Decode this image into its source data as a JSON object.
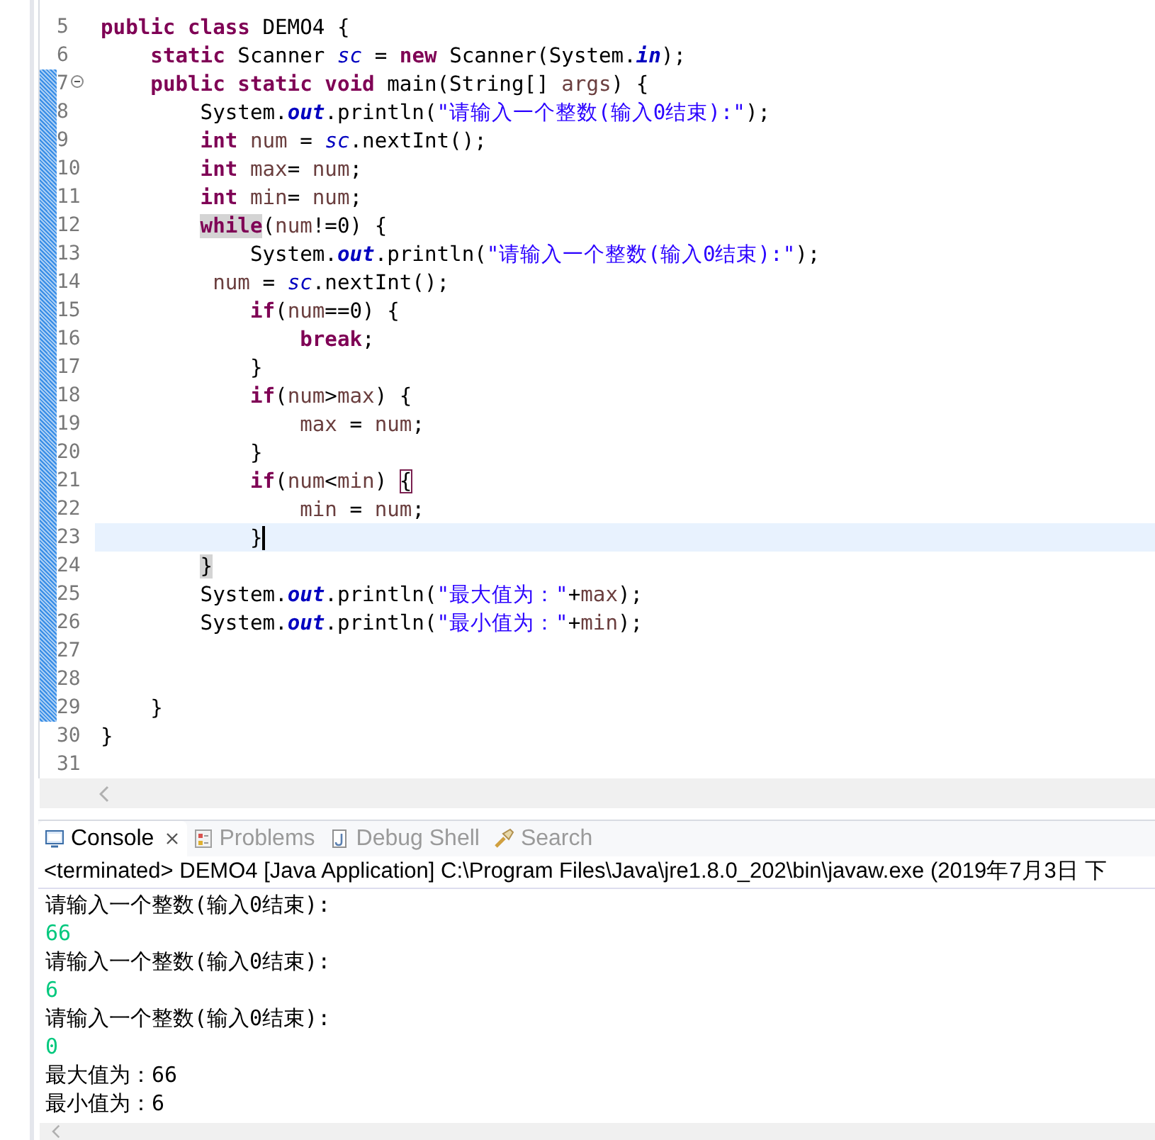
{
  "editor": {
    "lines": [
      {
        "number": "5",
        "changed": false,
        "current": false,
        "fold": false,
        "tokens": [
          {
            "kind": "kw",
            "text": "public class"
          },
          {
            "kind": "text",
            "text": " DEMO4 {"
          }
        ]
      },
      {
        "number": "6",
        "changed": false,
        "current": false,
        "fold": false,
        "tokens": [
          {
            "kind": "kw",
            "text": "    static"
          },
          {
            "kind": "text",
            "text": " Scanner "
          },
          {
            "kind": "field",
            "text": "sc"
          },
          {
            "kind": "text",
            "text": " = "
          },
          {
            "kind": "kw",
            "text": "new"
          },
          {
            "kind": "text",
            "text": " Scanner(System."
          },
          {
            "kind": "sfield",
            "text": "in"
          },
          {
            "kind": "text",
            "text": ");"
          }
        ]
      },
      {
        "number": "7",
        "changed": true,
        "current": false,
        "fold": true,
        "tokens": [
          {
            "kind": "kw",
            "text": "    public static void"
          },
          {
            "kind": "text",
            "text": " main(String[] "
          },
          {
            "kind": "var",
            "text": "args"
          },
          {
            "kind": "text",
            "text": ") {"
          }
        ]
      },
      {
        "number": "8",
        "changed": true,
        "current": false,
        "fold": false,
        "tokens": [
          {
            "kind": "text",
            "text": "        System."
          },
          {
            "kind": "sfield",
            "text": "out"
          },
          {
            "kind": "text",
            "text": ".println("
          },
          {
            "kind": "str",
            "text": "\"请输入一个整数(输入0结束):\""
          },
          {
            "kind": "text",
            "text": ");"
          }
        ]
      },
      {
        "number": "9",
        "changed": true,
        "current": false,
        "fold": false,
        "tokens": [
          {
            "kind": "kw",
            "text": "        int "
          },
          {
            "kind": "var",
            "text": "num"
          },
          {
            "kind": "text",
            "text": " = "
          },
          {
            "kind": "field",
            "text": "sc"
          },
          {
            "kind": "text",
            "text": ".nextInt();"
          }
        ]
      },
      {
        "number": "10",
        "changed": true,
        "current": false,
        "fold": false,
        "tokens": [
          {
            "kind": "kw",
            "text": "        int "
          },
          {
            "kind": "var",
            "text": "max"
          },
          {
            "kind": "text",
            "text": "= "
          },
          {
            "kind": "var",
            "text": "num"
          },
          {
            "kind": "text",
            "text": ";"
          }
        ]
      },
      {
        "number": "11",
        "changed": true,
        "current": false,
        "fold": false,
        "tokens": [
          {
            "kind": "kw",
            "text": "        int "
          },
          {
            "kind": "var",
            "text": "min"
          },
          {
            "kind": "text",
            "text": "= "
          },
          {
            "kind": "var",
            "text": "num"
          },
          {
            "kind": "text",
            "text": ";"
          }
        ]
      },
      {
        "number": "12",
        "changed": true,
        "current": false,
        "fold": false,
        "tokens": [
          {
            "kind": "kw",
            "text": "        while",
            "highlighted": true
          },
          {
            "kind": "text",
            "text": "("
          },
          {
            "kind": "var",
            "text": "num"
          },
          {
            "kind": "text",
            "text": "!=0) {"
          }
        ]
      },
      {
        "number": "13",
        "changed": true,
        "current": false,
        "fold": false,
        "tokens": [
          {
            "kind": "text",
            "text": "            System."
          },
          {
            "kind": "sfield",
            "text": "out"
          },
          {
            "kind": "text",
            "text": ".println("
          },
          {
            "kind": "str",
            "text": "\"请输入一个整数(输入0结束):\""
          },
          {
            "kind": "text",
            "text": ");"
          }
        ]
      },
      {
        "number": "14",
        "changed": true,
        "current": false,
        "fold": false,
        "tokens": [
          {
            "kind": "var",
            "text": "         num"
          },
          {
            "kind": "text",
            "text": " = "
          },
          {
            "kind": "field",
            "text": "sc"
          },
          {
            "kind": "text",
            "text": ".nextInt();"
          }
        ]
      },
      {
        "number": "15",
        "changed": true,
        "current": false,
        "fold": false,
        "tokens": [
          {
            "kind": "kw",
            "text": "            if"
          },
          {
            "kind": "text",
            "text": "("
          },
          {
            "kind": "var",
            "text": "num"
          },
          {
            "kind": "text",
            "text": "==0) {"
          }
        ]
      },
      {
        "number": "16",
        "changed": true,
        "current": false,
        "fold": false,
        "tokens": [
          {
            "kind": "kw",
            "text": "                break"
          },
          {
            "kind": "text",
            "text": ";"
          }
        ]
      },
      {
        "number": "17",
        "changed": true,
        "current": false,
        "fold": false,
        "tokens": [
          {
            "kind": "text",
            "text": "            }"
          }
        ]
      },
      {
        "number": "18",
        "changed": true,
        "current": false,
        "fold": false,
        "tokens": [
          {
            "kind": "kw",
            "text": "            if"
          },
          {
            "kind": "text",
            "text": "("
          },
          {
            "kind": "var",
            "text": "num"
          },
          {
            "kind": "text",
            "text": ">"
          },
          {
            "kind": "var",
            "text": "max"
          },
          {
            "kind": "text",
            "text": ") {"
          }
        ]
      },
      {
        "number": "19",
        "changed": true,
        "current": false,
        "fold": false,
        "tokens": [
          {
            "kind": "var",
            "text": "                max"
          },
          {
            "kind": "text",
            "text": " = "
          },
          {
            "kind": "var",
            "text": "num"
          },
          {
            "kind": "text",
            "text": ";"
          }
        ]
      },
      {
        "number": "20",
        "changed": true,
        "current": false,
        "fold": false,
        "tokens": [
          {
            "kind": "text",
            "text": "            }"
          }
        ]
      },
      {
        "number": "21",
        "changed": true,
        "current": false,
        "fold": false,
        "tokens": [
          {
            "kind": "kw",
            "text": "            if"
          },
          {
            "kind": "text",
            "text": "("
          },
          {
            "kind": "var",
            "text": "num"
          },
          {
            "kind": "text",
            "text": "<"
          },
          {
            "kind": "var",
            "text": "min"
          },
          {
            "kind": "text",
            "text": ") "
          },
          {
            "kind": "text",
            "text": "{",
            "matched": true
          }
        ]
      },
      {
        "number": "22",
        "changed": true,
        "current": false,
        "fold": false,
        "tokens": [
          {
            "kind": "var",
            "text": "                min"
          },
          {
            "kind": "text",
            "text": " = "
          },
          {
            "kind": "var",
            "text": "num"
          },
          {
            "kind": "text",
            "text": ";"
          }
        ]
      },
      {
        "number": "23",
        "changed": true,
        "current": true,
        "fold": false,
        "tokens": [
          {
            "kind": "text",
            "text": "            }"
          }
        ]
      },
      {
        "number": "24",
        "changed": true,
        "current": false,
        "fold": false,
        "tokens": [
          {
            "kind": "text",
            "text": "        }",
            "highlighted": true
          }
        ]
      },
      {
        "number": "25",
        "changed": true,
        "current": false,
        "fold": false,
        "tokens": [
          {
            "kind": "text",
            "text": "        System."
          },
          {
            "kind": "sfield",
            "text": "out"
          },
          {
            "kind": "text",
            "text": ".println("
          },
          {
            "kind": "str",
            "text": "\"最大值为：\""
          },
          {
            "kind": "text",
            "text": "+"
          },
          {
            "kind": "var",
            "text": "max"
          },
          {
            "kind": "text",
            "text": ");"
          }
        ]
      },
      {
        "number": "26",
        "changed": true,
        "current": false,
        "fold": false,
        "tokens": [
          {
            "kind": "text",
            "text": "        System."
          },
          {
            "kind": "sfield",
            "text": "out"
          },
          {
            "kind": "text",
            "text": ".println("
          },
          {
            "kind": "str",
            "text": "\"最小值为：\""
          },
          {
            "kind": "text",
            "text": "+"
          },
          {
            "kind": "var",
            "text": "min"
          },
          {
            "kind": "text",
            "text": ");"
          }
        ]
      },
      {
        "number": "27",
        "changed": true,
        "current": false,
        "fold": false
      },
      {
        "number": "28",
        "changed": true,
        "current": false,
        "fold": false
      },
      {
        "number": "29",
        "changed": true,
        "current": false,
        "fold": false,
        "tokens": [
          {
            "kind": "text",
            "text": "    }"
          }
        ]
      },
      {
        "number": "30",
        "changed": false,
        "current": false,
        "fold": false,
        "tokens": [
          {
            "kind": "text",
            "text": "}"
          }
        ]
      },
      {
        "number": "31",
        "changed": false,
        "current": false,
        "fold": false
      }
    ]
  },
  "console": {
    "tabs": [
      {
        "label": "Console",
        "selected": true
      },
      {
        "label": "Problems",
        "selected": false
      },
      {
        "label": "Debug Shell",
        "selected": false
      },
      {
        "label": "Search",
        "selected": false
      }
    ],
    "header": "<terminated> DEMO4 [Java Application] C:\\Program Files\\Java\\jre1.8.0_202\\bin\\javaw.exe (2019年7月3日 下",
    "output": [
      {
        "kind": "out",
        "text": "请输入一个整数(输入0结束):"
      },
      {
        "kind": "in",
        "text": "66"
      },
      {
        "kind": "out",
        "text": "请输入一个整数(输入0结束):"
      },
      {
        "kind": "in",
        "text": "6"
      },
      {
        "kind": "out",
        "text": "请输入一个整数(输入0结束):"
      },
      {
        "kind": "in",
        "text": "0"
      },
      {
        "kind": "out",
        "text": "最大值为：66"
      },
      {
        "kind": "out",
        "text": "最小值为：6"
      }
    ]
  }
}
